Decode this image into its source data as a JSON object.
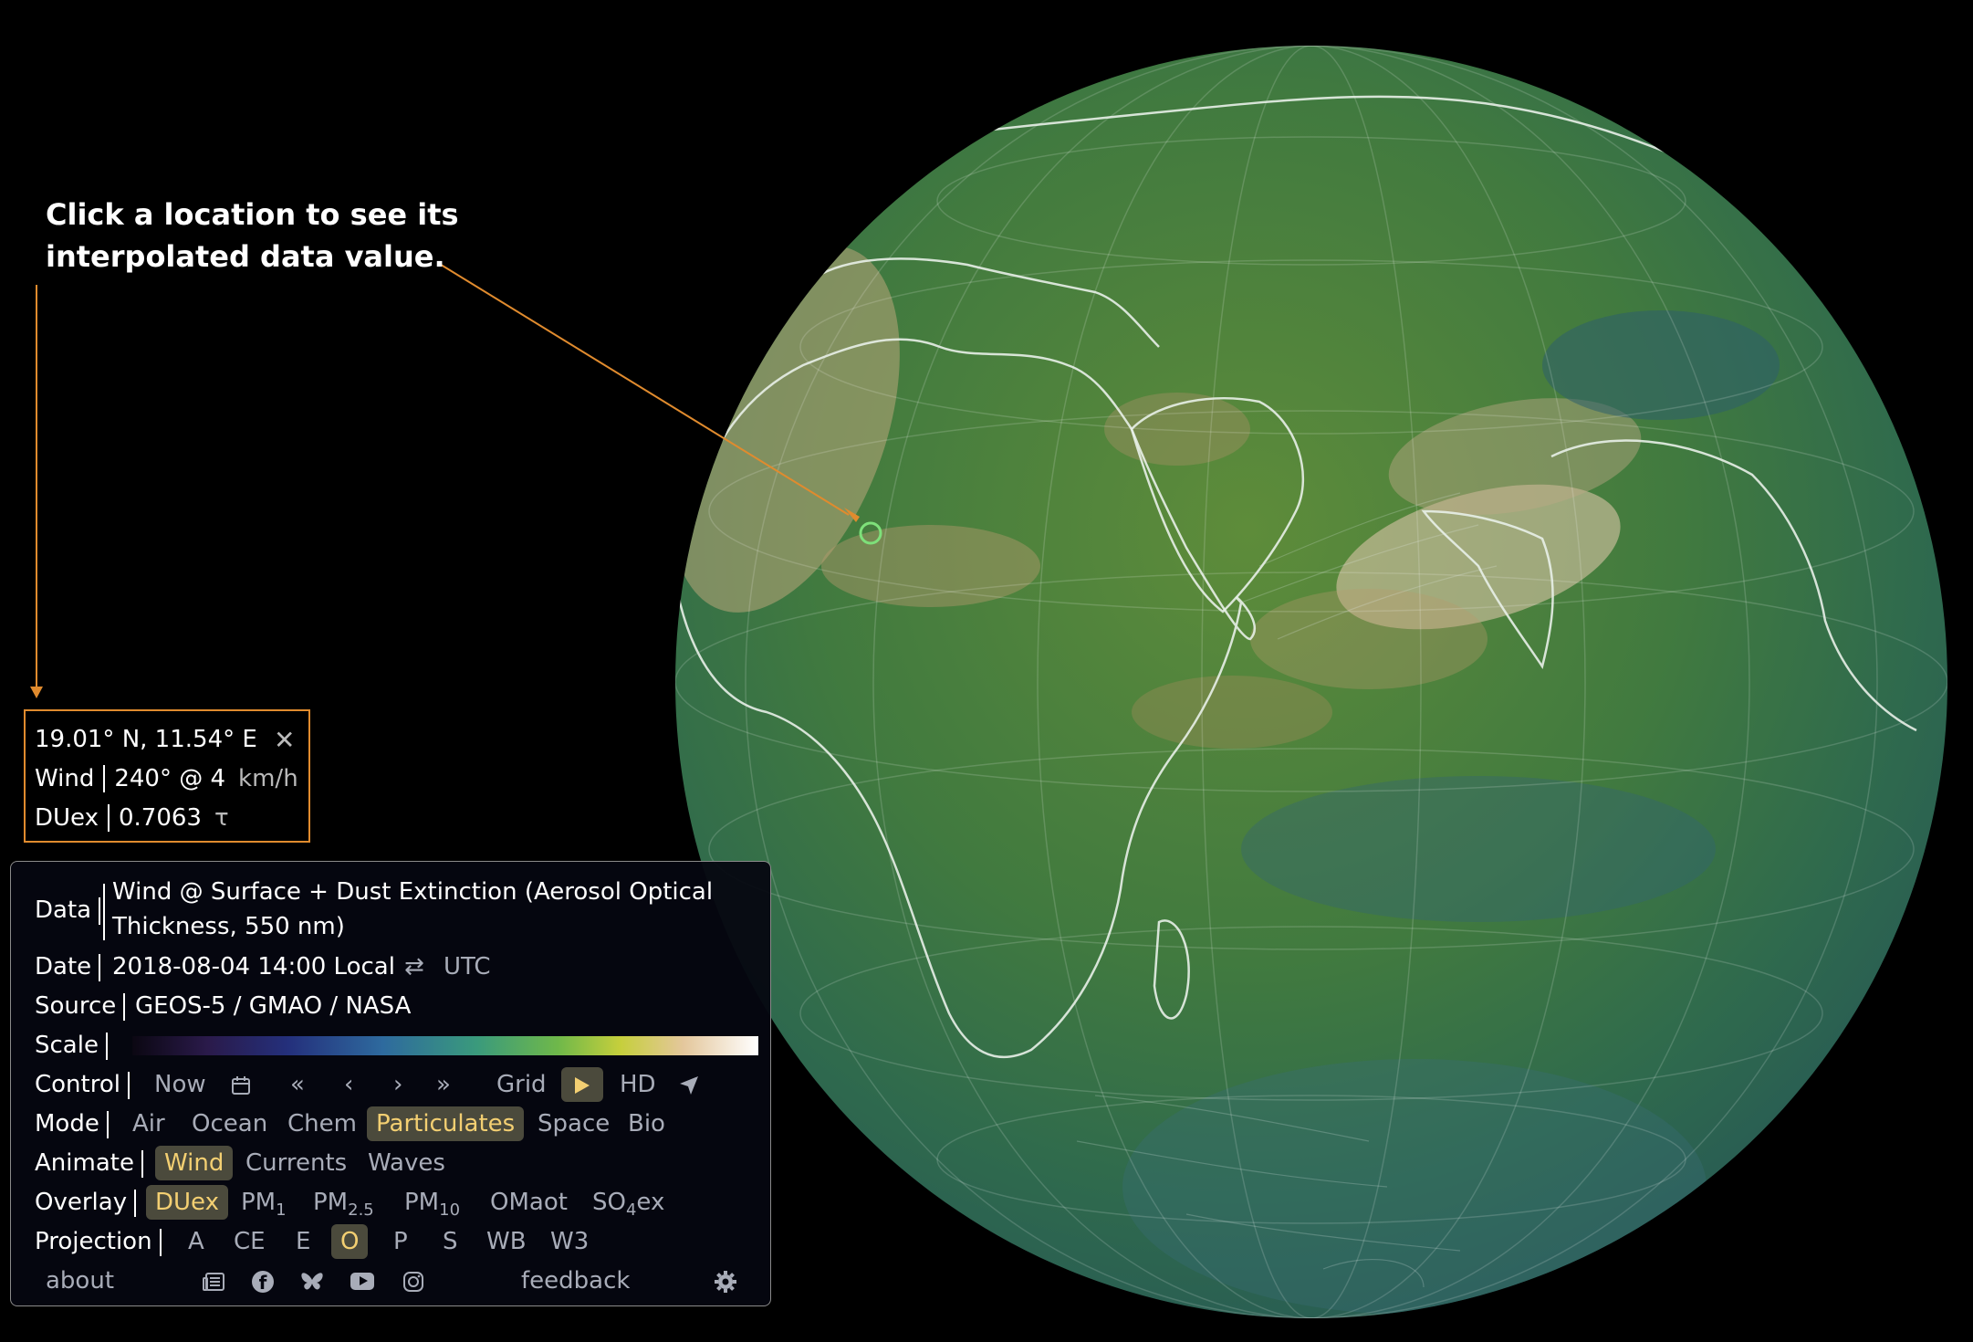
{
  "annotation": {
    "line1": "Click a location to see its",
    "line2": "interpolated data value."
  },
  "tooltip": {
    "coords": "19.01° N, 11.54° E",
    "close_icon": "close-icon",
    "wind_label": "Wind",
    "wind_value": "240° @ 4",
    "wind_unit": "km/h",
    "overlay_label": "DUex",
    "overlay_value": "0.7063",
    "overlay_unit": "τ"
  },
  "menu": {
    "data_label": "Data",
    "data_line1": "Wind @ Surface + Dust Extinction (Aerosol Optical",
    "data_line2": "Thickness, 550 nm)",
    "date_label": "Date",
    "date_value": "2018-08-04 14:00 Local",
    "date_toggle_icon": "swap-arrows-icon",
    "date_utc": "UTC",
    "source_label": "Source",
    "source_value": "GEOS-5 / GMAO / NASA",
    "scale_label": "Scale",
    "control_label": "Control",
    "control_now": "Now",
    "control_grid": "Grid",
    "control_hd": "HD",
    "mode_label": "Mode",
    "mode_items": [
      "Air",
      "Ocean",
      "Chem",
      "Particulates",
      "Space",
      "Bio"
    ],
    "mode_selected": "Particulates",
    "animate_label": "Animate",
    "animate_items": [
      "Wind",
      "Currents",
      "Waves"
    ],
    "animate_selected": "Wind",
    "overlay_label": "Overlay",
    "overlay_duex": "DUex",
    "overlay_pm": "PM",
    "overlay_pm1_sub": "1",
    "overlay_pm25_sub": "2.5",
    "overlay_pm10_sub": "10",
    "overlay_omaot": "OMaot",
    "overlay_so4_a": "SO",
    "overlay_so4_sub": "4",
    "overlay_so4_b": "ex",
    "projection_label": "Projection",
    "projection_items": [
      "A",
      "CE",
      "E",
      "O",
      "P",
      "S",
      "WB",
      "W3"
    ],
    "projection_selected": "O",
    "about": "about",
    "feedback": "feedback"
  },
  "colors": {
    "accent_orange": "#e08b2e",
    "selected_text": "#f3cf72",
    "marker_green": "#7ee07a",
    "ocean_green": "#3c7a4c",
    "dust_tan": "#c7a878"
  }
}
